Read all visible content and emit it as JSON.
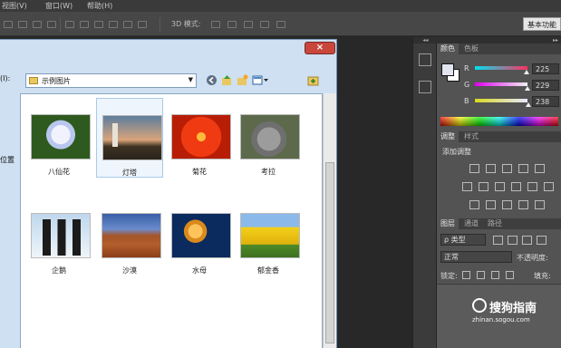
{
  "menubar": {
    "items": [
      "视图(V)",
      "窗口(W)",
      "帮助(H)"
    ]
  },
  "optionsbar": {
    "mode_3d_label": "3D 模式:",
    "workspace_label": "基本功能"
  },
  "dialog": {
    "look_in_label": "(I):",
    "look_in_value": "示例图片",
    "places_label": "位置",
    "close_symbol": "×",
    "files": [
      {
        "name": "八仙花",
        "thumb": "hydrangea",
        "selected": false
      },
      {
        "name": "灯塔",
        "thumb": "lighthouse",
        "selected": true
      },
      {
        "name": "菊花",
        "thumb": "chrysanthemum",
        "selected": false
      },
      {
        "name": "考拉",
        "thumb": "koala",
        "selected": false
      },
      {
        "name": "企鹅",
        "thumb": "penguins",
        "selected": false
      },
      {
        "name": "沙漠",
        "thumb": "desert",
        "selected": false
      },
      {
        "name": "水母",
        "thumb": "jellyfish",
        "selected": false
      },
      {
        "name": "郁金香",
        "thumb": "tulips",
        "selected": false
      }
    ]
  },
  "color_panel": {
    "tabs": [
      "颜色",
      "色板"
    ],
    "channels": [
      {
        "label": "R",
        "value": "225",
        "gradient_to": "#ff2020"
      },
      {
        "label": "G",
        "value": "229",
        "gradient_to": "#20ff20"
      },
      {
        "label": "B",
        "value": "238",
        "gradient_to": "#2020ff"
      }
    ],
    "foreground": "#e1e5ee"
  },
  "adjust_panel": {
    "tabs": [
      "调整",
      "样式"
    ],
    "title": "添加调整"
  },
  "layers_panel": {
    "tabs": [
      "图层",
      "通道",
      "路径"
    ],
    "filter_label": "ρ 类型",
    "blend_mode": "正常",
    "opacity_label": "不透明度:",
    "lock_label": "锁定:",
    "fill_label": "填充:"
  },
  "watermark": {
    "name": "搜狗指南",
    "url": "zhinan.sogou.com"
  }
}
